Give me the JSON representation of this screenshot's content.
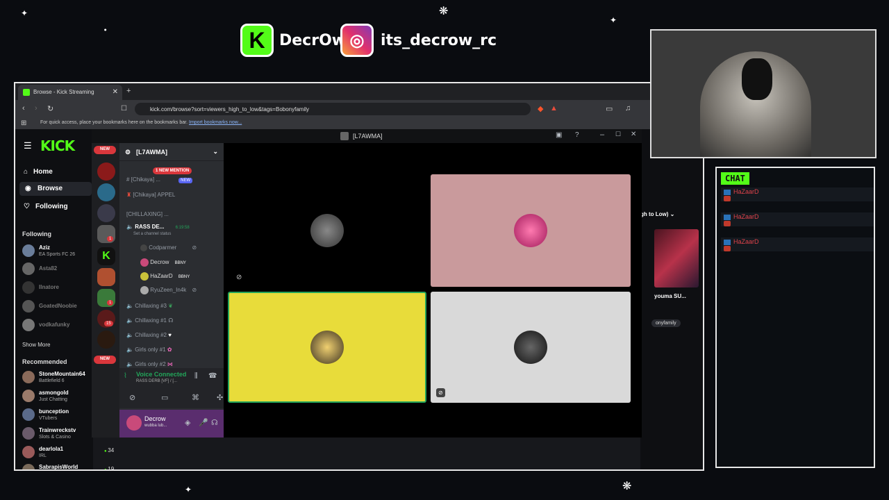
{
  "overlay": {
    "kick_handle": "DecrOw",
    "instagram_handle": "its_decrow_rc"
  },
  "browser": {
    "tab_title": "Browse - Kick Streaming",
    "url": "kick.com/browse?sort=viewers_high_to_low&tags=Bobonyfamily",
    "bookmarks_hint": "For quick access, place your bookmarks here on the bookmarks bar.",
    "bookmarks_link": "Import bookmarks now..."
  },
  "kick": {
    "logo": "KICK",
    "nav": [
      {
        "label": "Home",
        "icon": "home-icon"
      },
      {
        "label": "Browse",
        "icon": "compass-icon"
      },
      {
        "label": "Following",
        "icon": "heart-icon"
      }
    ],
    "following_label": "Following",
    "following": [
      {
        "name": "Aziz",
        "category": "EA Sports FC 26"
      },
      {
        "name": "Asta82",
        "category": ""
      },
      {
        "name": "Ilnatore",
        "category": ""
      },
      {
        "name": "GoatedNoobie",
        "category": ""
      },
      {
        "name": "vodkafunky",
        "category": ""
      }
    ],
    "show_more": "Show More",
    "recommended_label": "Recommended",
    "recommended": [
      {
        "name": "StoneMountain64",
        "category": "Battlefield 6"
      },
      {
        "name": "asmongold",
        "category": "Just Chatting"
      },
      {
        "name": "bunception",
        "category": "VTubers"
      },
      {
        "name": "Trainwreckstv",
        "category": "Slots & Casino"
      },
      {
        "name": "dearlola1",
        "category": "IRL",
        "viewers": "34"
      },
      {
        "name": "SabrapisWorld",
        "category": "",
        "viewers": "19"
      }
    ],
    "sort_label": "gh to Low)",
    "card_title": "youma SU...",
    "card_tag": "onyfamily"
  },
  "discord": {
    "window_title": "[L7AWMA]",
    "server_name": "[L7AWMA]",
    "new_pill": "NEW",
    "new_mention": "1 NEW MENTION",
    "channels": [
      {
        "label": "[Chikaya] ...",
        "tag": "NEW"
      },
      {
        "label": "[Chikaya] APPEL"
      },
      {
        "label": "[CHILLAXING] ..."
      },
      {
        "label": "RASS DE...",
        "time": "6:19:58"
      },
      {
        "label": "Set a channel status"
      }
    ],
    "voice_users": [
      {
        "name": "Codparmer",
        "tag": ""
      },
      {
        "name": "Decrow",
        "tag": "BBNY"
      },
      {
        "name": "HaZaarD",
        "tag": "BBNY"
      },
      {
        "name": "RyuZeen_In4k",
        "tag": ""
      }
    ],
    "more_channels": [
      "Chillaxing #3",
      "Chillaxing #1",
      "Chillaxing #2",
      "Girls only #1",
      "Girls only #2"
    ],
    "voice_status": "Voice Connected",
    "voice_channel": "RASS DERB [VF] / [...",
    "user_name": "Decrow",
    "user_status": "wubba lub...",
    "unread_counts": [
      "1",
      "1",
      "15"
    ],
    "tile_colors": [
      "#000000",
      "#c99a9c",
      "#e8dc3a",
      "#d9d9d9"
    ]
  },
  "chat": {
    "title": "CHAT",
    "messages": [
      {
        "user": "HaZaarD"
      },
      {
        "user": "HaZaarD"
      },
      {
        "user": "HaZaarD"
      }
    ]
  }
}
